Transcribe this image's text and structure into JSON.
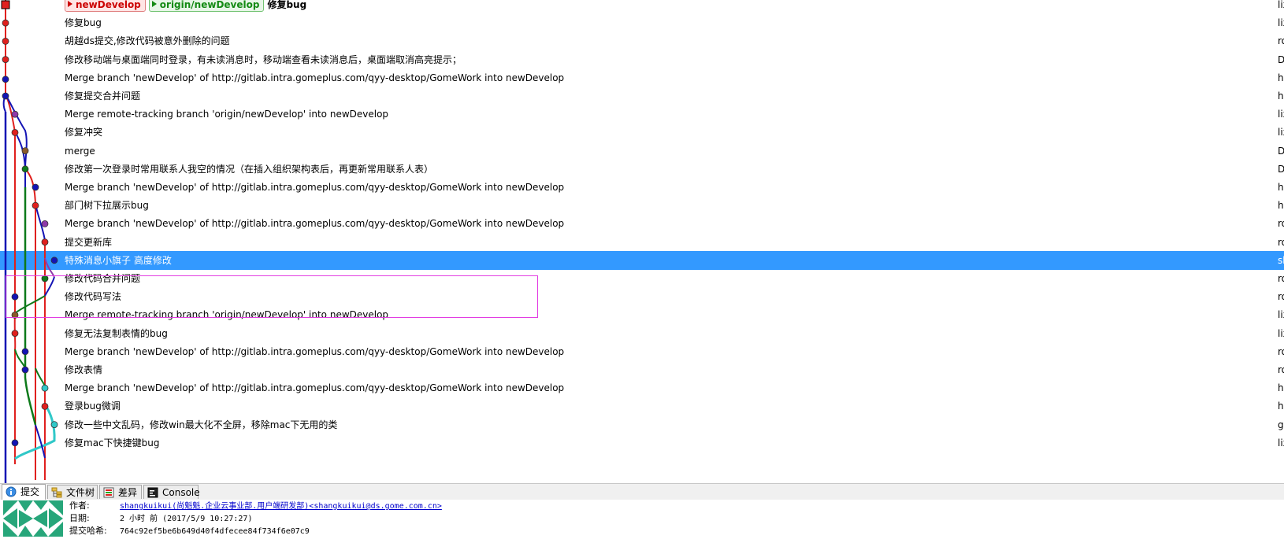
{
  "colors": {
    "selection": "#3399ff",
    "highlight_box": "#e23ee2",
    "red": "#e0201e",
    "blue": "#1414b4",
    "green": "#0d7a1a",
    "teal": "#30c8c8",
    "brown": "#8a5a2b",
    "purple": "#8e3aa8"
  },
  "refs": {
    "local_branch": "newDevelop",
    "remote_branch": "origin/newDevelop"
  },
  "commits": [
    {
      "message": "修复bug",
      "author": "lix"
    },
    {
      "message": "修复bug",
      "author": "lix"
    },
    {
      "message": "胡越ds提交,修改代码被意外删除的问题",
      "author": "ro"
    },
    {
      "message": "修改移动端与桌面端同时登录，有未读消息时，移动端查看未读消息后，桌面端取消高亮提示；",
      "author": "DS"
    },
    {
      "message": "Merge branch 'newDevelop' of http://gitlab.intra.gomeplus.com/qyy-desktop/GomeWork into newDevelop",
      "author": "hu"
    },
    {
      "message": "修复提交合并问题",
      "author": "hu"
    },
    {
      "message": "Merge remote-tracking branch 'origin/newDevelop' into newDevelop",
      "author": "lix"
    },
    {
      "message": "修复冲突",
      "author": "lix"
    },
    {
      "message": "merge",
      "author": "DS"
    },
    {
      "message": "修改第一次登录时常用联系人我空的情况（在插入组织架构表后，再更新常用联系人表）",
      "author": "DS"
    },
    {
      "message": "Merge branch 'newDevelop' of http://gitlab.intra.gomeplus.com/qyy-desktop/GomeWork into newDevelop",
      "author": "hu"
    },
    {
      "message": "部门树下拉展示bug",
      "author": "hu"
    },
    {
      "message": "Merge branch 'newDevelop' of http://gitlab.intra.gomeplus.com/qyy-desktop/GomeWork into newDevelop",
      "author": "ro"
    },
    {
      "message": "提交更新库",
      "author": "ro"
    },
    {
      "message": "特殊消息小旗子 高度修改",
      "author": "sh"
    },
    {
      "message": "修改代码合并问题",
      "author": "ro"
    },
    {
      "message": "修改代码写法",
      "author": "ro"
    },
    {
      "message": "Merge remote-tracking branch 'origin/newDevelop' into newDevelop",
      "author": "lix"
    },
    {
      "message": "修复无法复制表情的bug",
      "author": "lix"
    },
    {
      "message": "Merge branch 'newDevelop' of http://gitlab.intra.gomeplus.com/qyy-desktop/GomeWork into newDevelop",
      "author": "ro"
    },
    {
      "message": "修改表情",
      "author": "ro"
    },
    {
      "message": "Merge branch 'newDevelop' of http://gitlab.intra.gomeplus.com/qyy-desktop/GomeWork into newDevelop",
      "author": "hu"
    },
    {
      "message": "登录bug微调",
      "author": "hu"
    },
    {
      "message": "修改一些中文乱码，修改win最大化不全屏，移除mac下无用的类",
      "author": "go"
    },
    {
      "message": "修复mac下快捷键bug",
      "author": "lix"
    },
    {
      "message": "",
      "author": ""
    }
  ],
  "tabs": [
    {
      "label": "提交",
      "icon": "commit-info-icon"
    },
    {
      "label": "文件树",
      "icon": "file-tree-icon"
    },
    {
      "label": "差异",
      "icon": "diff-icon"
    },
    {
      "label": "Console",
      "icon": "console-icon"
    }
  ],
  "details": {
    "author_label": "作者:",
    "author_value": "shangkuikui(尚魁魁.企业云事业部.用户端研发部)<shangkuikui@ds.gome.com.cn>",
    "date_label": "日期:",
    "date_value": "2 小时 前 (2017/5/9 10:27:27)",
    "hash_label": "提交哈希:",
    "hash_value": "764c92ef5be6b649d40f4dfecee84f734f6e07c9"
  }
}
